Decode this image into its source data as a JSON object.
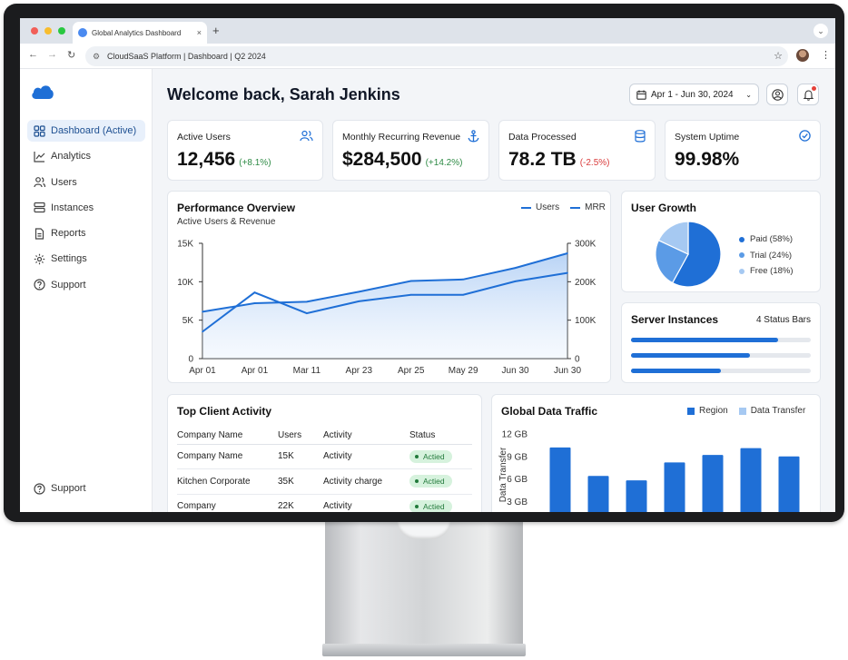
{
  "browser": {
    "tab_title": "Global Analytics Dashboard",
    "address": "CloudSaaS Platform | Dashboard | Q2 2024",
    "tab_close": "×",
    "new_tab": "+"
  },
  "sidebar": {
    "items": [
      {
        "label": "Dashboard (Active)",
        "icon": "grid-icon"
      },
      {
        "label": "Analytics",
        "icon": "chart-line-icon"
      },
      {
        "label": "Users",
        "icon": "users-icon"
      },
      {
        "label": "Instances",
        "icon": "server-icon"
      },
      {
        "label": "Reports",
        "icon": "file-icon"
      },
      {
        "label": "Settings",
        "icon": "gear-icon"
      },
      {
        "label": "Support",
        "icon": "help-icon"
      }
    ],
    "bottom_item": {
      "label": "Support",
      "icon": "help-icon"
    }
  },
  "header": {
    "welcome": "Welcome back, Sarah Jenkins",
    "date_range": "Apr 1 - Jun 30, 2024"
  },
  "kpis": [
    {
      "label": "Active Users",
      "value": "12,456",
      "change": "(+8.1%)",
      "trend": "up",
      "icon": "users-icon"
    },
    {
      "label": "Monthly Recurring Revenue",
      "value": "$284,500",
      "change": "(+14.2%)",
      "trend": "up",
      "icon": "anchor-icon"
    },
    {
      "label": "Data Processed",
      "value": "78.2 TB",
      "change": "(-2.5%)",
      "trend": "down",
      "icon": "database-icon"
    },
    {
      "label": "System Uptime",
      "value": "99.98%",
      "change": "",
      "trend": "none",
      "icon": "check-circle-icon"
    }
  ],
  "performance": {
    "title": "Performance Overview",
    "subtitle": "Active Users & Revenue",
    "legend": [
      "Users",
      "MRR"
    ]
  },
  "user_growth": {
    "title": "User Growth",
    "legend": [
      "Paid (58%)",
      "Trial (24%)",
      "Free (18%)"
    ]
  },
  "servers": {
    "title": "Server Instances",
    "count_label": "4 Status Bars",
    "bars": [
      0.82,
      0.66,
      0.5
    ]
  },
  "clients": {
    "title": "Top Client Activity",
    "headers": [
      "Company Name",
      "Users",
      "Activity",
      "Status"
    ],
    "rows": [
      {
        "company": "Company Name",
        "users": "15K",
        "activity": "Activity",
        "status": "Actied"
      },
      {
        "company": "Kitchen Corporate",
        "users": "35K",
        "activity": "Activity charge",
        "status": "Actied"
      },
      {
        "company": "Company",
        "users": "22K",
        "activity": "Activity",
        "status": "Actied"
      }
    ]
  },
  "traffic": {
    "title": "Global Data Traffic",
    "legend": [
      "Region",
      "Data Transfer"
    ]
  },
  "colors": {
    "accent": "#1f6fd6",
    "accent_light": "#9cc3f0",
    "success": "#2e8b45",
    "danger": "#d93b3b"
  },
  "chart_data": [
    {
      "type": "line",
      "title": "Performance Overview",
      "subtitle": "Active Users & Revenue",
      "categories": [
        "Apr 01",
        "Apr 01",
        "Mar 11",
        "Apr 23",
        "Apr 25",
        "May 29",
        "Jun 30",
        "Jun 30"
      ],
      "y_ticks": [
        "0",
        "5K",
        "10K",
        "15K"
      ],
      "y2_ticks": [
        "0",
        "100K",
        "200K",
        "300K"
      ],
      "ylim": [
        0,
        15000
      ],
      "y2lim": [
        0,
        300000
      ],
      "series": [
        {
          "name": "Users",
          "axis": "left",
          "values": [
            6100,
            7200,
            7400,
            8700,
            10100,
            10300,
            11800,
            13700
          ]
        },
        {
          "name": "MRR",
          "axis": "right",
          "values": [
            70000,
            172000,
            118000,
            149000,
            166000,
            166000,
            201000,
            223000
          ]
        }
      ],
      "legend": "top-right",
      "grid": false
    },
    {
      "type": "pie",
      "title": "User Growth",
      "labels": [
        "Paid",
        "Trial",
        "Free"
      ],
      "values": [
        58,
        24,
        18
      ],
      "colors": [
        "#1f6fd6",
        "#5b9be6",
        "#a6c9f2"
      ],
      "legend": "right"
    },
    {
      "type": "bar",
      "title": "Global Data Traffic",
      "ylabel": "Data Transfer",
      "y_ticks": [
        "3 GB",
        "6 GB",
        "9 GB",
        "12 GB"
      ],
      "ylim": [
        0,
        12
      ],
      "series": [
        {
          "name": "Region",
          "values": [
            10.2,
            6.4,
            5.8,
            8.2,
            9.2,
            10.1,
            9.0
          ]
        }
      ],
      "legend": "top-right",
      "grid": false
    }
  ]
}
